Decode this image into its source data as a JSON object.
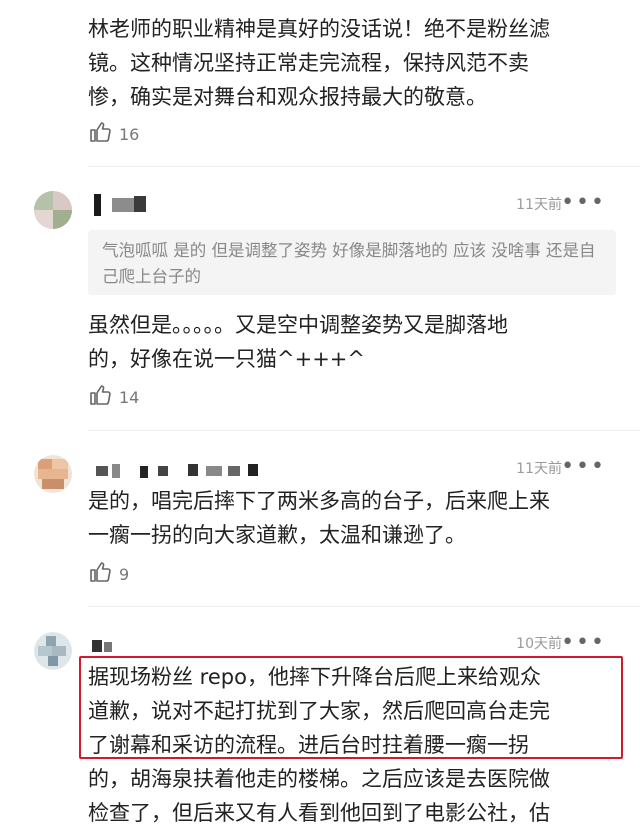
{
  "comments": [
    {
      "text": "林老师的职业精神是真好的没话说！绝不是粉丝滤\n镜。这种情况坚持正常走完流程，保持风范不卖\n惨，确实是对舞台和观众报持最大的敬意。",
      "likes": "16"
    },
    {
      "time": "11天前",
      "quote": "气泡呱呱 是的 但是调整了姿势 好像是脚落地的 应该\n没啥事 还是自己爬上台子的",
      "text": "虽然但是。。。。。又是空中调整姿势又是脚落地\n的，好像在说一只猫^+++^",
      "likes": "14"
    },
    {
      "time": "11天前",
      "text": "是的，唱完后摔下了两米多高的台子，后来爬上来\n一瘸一拐的向大家道歉，太温和谦逊了。",
      "likes": "9"
    },
    {
      "time": "10天前",
      "text": "据现场粉丝 repo，他摔下升降台后爬上来给观众\n道歉，说对不起打扰到了大家，然后爬回高台走完\n了谢幕和采访的流程。进后台时拄着腰一瘸一拐\n的，胡海泉扶着他走的楼梯。之后应该是去医院做\n检查了，但后来又有人看到他回到了电影公社，估"
    }
  ],
  "ui": {
    "more_glyph": "•••"
  },
  "colors": {
    "highlight_border": "#d2192d",
    "quote_bg": "#f4f4f4",
    "meta_text": "#9a9a9a"
  },
  "icons": [
    "thumbs-up-icon",
    "more-dots-icon",
    "avatar"
  ]
}
